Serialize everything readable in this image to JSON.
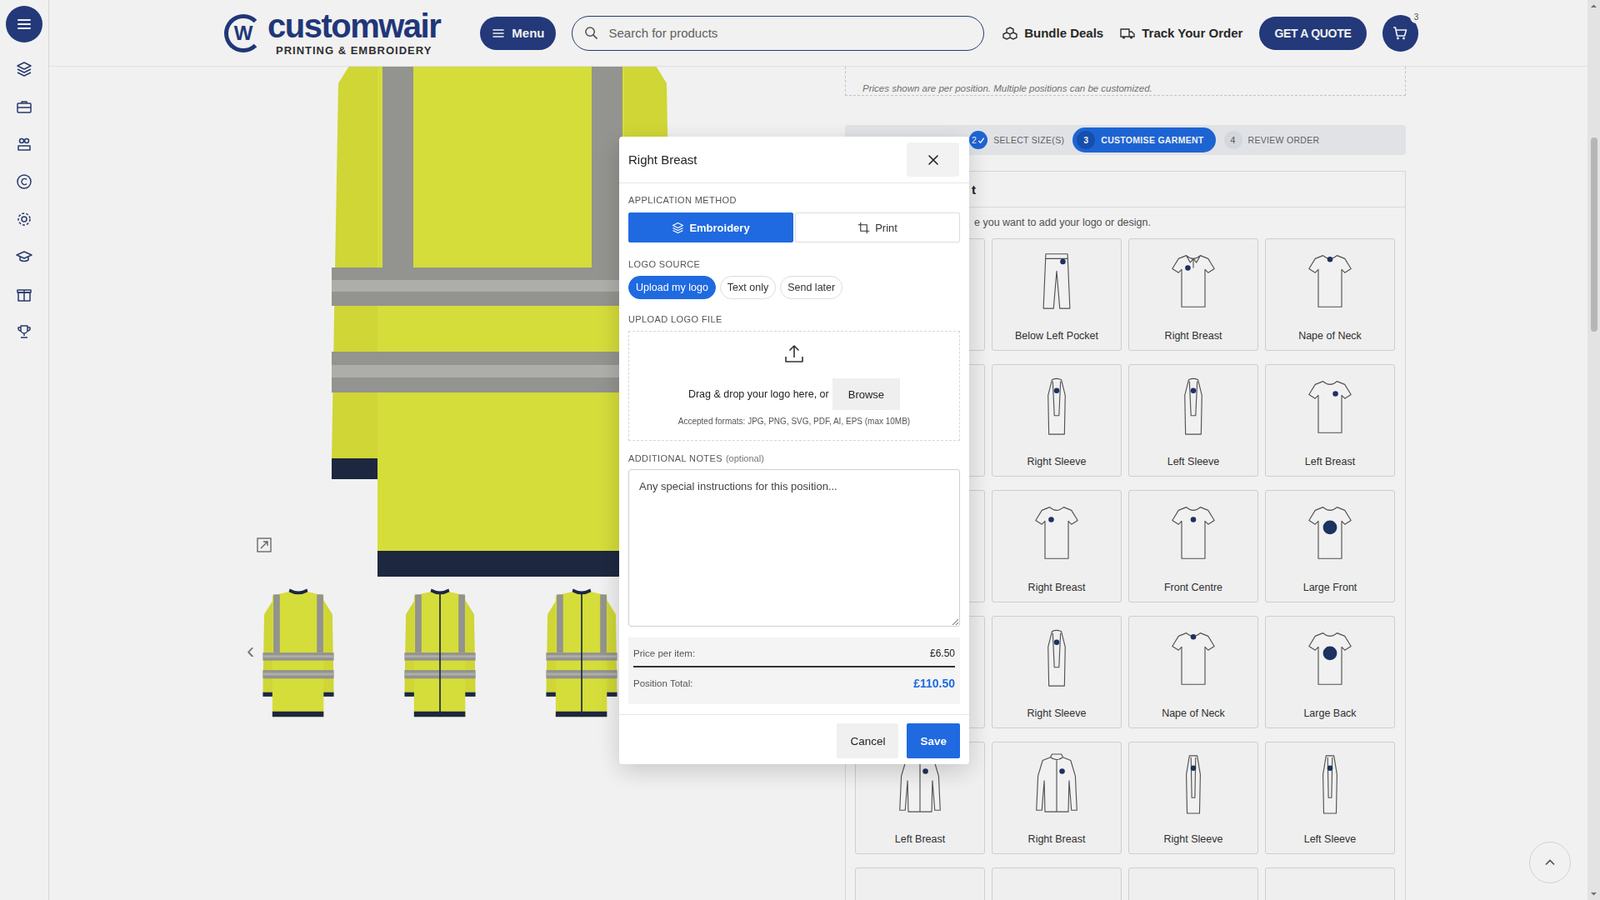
{
  "header": {
    "logo": {
      "mark": "W",
      "name": "customwair",
      "tagline": "PRINTING & EMBROIDERY"
    },
    "menu_button": "Menu",
    "search": {
      "placeholder": "Search for products"
    },
    "links": [
      "Bundle Deals",
      "Track Your Order"
    ],
    "quote_button": "GET A QUOTE",
    "cart": {
      "count": "3"
    }
  },
  "product": {
    "prev_arrow": "‹",
    "thumbnails": [
      {
        "kind": "back"
      },
      {
        "kind": "front"
      },
      {
        "kind": "front"
      }
    ]
  },
  "pricing_note": "Prices shown are per position. Multiple positions can be customized.",
  "steps": [
    {
      "number": "2",
      "label": "SELECT SIZE(S)",
      "done": true,
      "selected": false
    },
    {
      "number": "3",
      "label": "CUSTOMISE GARMENT",
      "done": false,
      "selected": true
    },
    {
      "number": "4",
      "label": "REVIEW ORDER",
      "done": false,
      "selected": false
    }
  ],
  "positions": {
    "heading": "t",
    "subtitle": "e you want to add your logo or design.",
    "cells": [
      {
        "label": "",
        "kind": "covered",
        "spot": "none"
      },
      {
        "label": "Below Left Pocket",
        "kind": "trousers",
        "spot": "pocket"
      },
      {
        "label": "Right Breast",
        "kind": "polo",
        "spot": "left"
      },
      {
        "label": "Nape of Neck",
        "kind": "tshirt",
        "spot": "top"
      },
      {
        "label": "",
        "kind": "covered",
        "spot": "none"
      },
      {
        "label": "Right Sleeve",
        "kind": "sleeve",
        "spot": "sleeve"
      },
      {
        "label": "Left Sleeve",
        "kind": "sleeve",
        "spot": "sleeve"
      },
      {
        "label": "Left Breast",
        "kind": "tshirt",
        "spot": "right"
      },
      {
        "label": "",
        "kind": "covered",
        "spot": "none"
      },
      {
        "label": "Right Breast",
        "kind": "tshirt",
        "spot": "left"
      },
      {
        "label": "Front Centre",
        "kind": "tshirt",
        "spot": "centre"
      },
      {
        "label": "Large Front",
        "kind": "tshirt",
        "spot": "large"
      },
      {
        "label": "",
        "kind": "covered",
        "spot": "none"
      },
      {
        "label": "Right Sleeve",
        "kind": "sleeve",
        "spot": "sleeve"
      },
      {
        "label": "Nape of Neck",
        "kind": "tshirt",
        "spot": "top"
      },
      {
        "label": "Large Back",
        "kind": "tshirt",
        "spot": "large"
      },
      {
        "label": "Left Breast",
        "kind": "jacket",
        "spot": "right"
      },
      {
        "label": "Right Breast",
        "kind": "jacket",
        "spot": "right"
      },
      {
        "label": "Right Sleeve",
        "kind": "jacketsleeve",
        "spot": "sleeve"
      },
      {
        "label": "Left Sleeve",
        "kind": "jacketsleeve",
        "spot": "sleeve"
      },
      {
        "label": "",
        "kind": "covered",
        "spot": "none"
      },
      {
        "label": "",
        "kind": "covered",
        "spot": "none"
      },
      {
        "label": "",
        "kind": "covered",
        "spot": "none"
      },
      {
        "label": "",
        "kind": "covered",
        "spot": "none"
      }
    ]
  },
  "modal": {
    "title": "Right Breast",
    "application_method": {
      "label": "APPLICATION METHOD",
      "options": [
        {
          "label": "Embroidery",
          "selected": true
        },
        {
          "label": "Print",
          "selected": false
        }
      ]
    },
    "logo_source": {
      "label": "LOGO SOURCE",
      "options": [
        {
          "label": "Upload my logo",
          "selected": true
        },
        {
          "label": "Text only",
          "selected": false
        },
        {
          "label": "Send later",
          "selected": false
        }
      ]
    },
    "upload": {
      "label": "UPLOAD LOGO FILE",
      "prompt": "Drag & drop your logo here, or",
      "browse": "Browse",
      "formats": "Accepted formats: JPG, PNG, SVG, PDF, AI, EPS (max 10MB)"
    },
    "notes": {
      "label": "ADDITIONAL NOTES",
      "hint": "(optional)",
      "placeholder": "Any special instructions for this position..."
    },
    "price": {
      "per_item_label": "Price per item:",
      "per_item": "£6.50",
      "total_label": "Position Total:",
      "total": "£110.50"
    },
    "buttons": [
      {
        "label": "Cancel",
        "primary": false
      },
      {
        "label": "Save",
        "primary": true
      }
    ]
  }
}
